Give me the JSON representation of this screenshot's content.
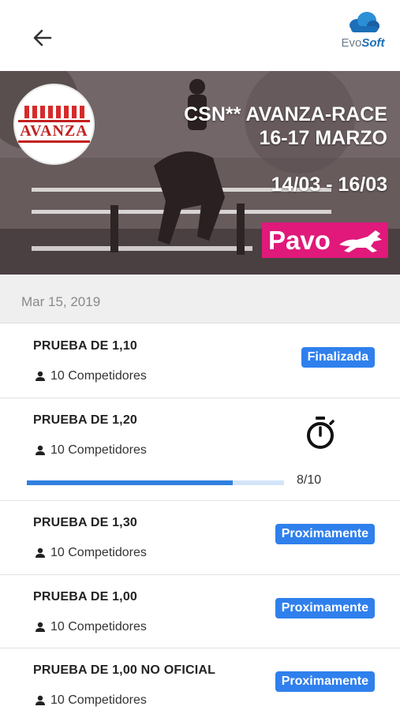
{
  "header": {
    "back_icon": "arrow-left-icon",
    "logo": {
      "evo": "Evo",
      "soft": "Soft"
    }
  },
  "banner": {
    "logo_text": "AVANZA",
    "title_line1": "CSN** AVANZA-RACE",
    "title_line2": "16-17 MARZO",
    "dates": "14/03 - 16/03",
    "sponsor": "Pavo"
  },
  "date_header": "Mar 15, 2019",
  "colors": {
    "accent": "#2f80ed",
    "progress_track": "#d3e4fa",
    "sponsor": "#e0197a"
  },
  "events": [
    {
      "title": "PRUEBA DE 1,10",
      "competitors": "10 Competidores",
      "status": "Finalizada"
    },
    {
      "title": "PRUEBA DE 1,20",
      "competitors": "10 Competidores",
      "status": "",
      "icon": "stopwatch-icon",
      "progress": 0.8,
      "progress_label": "8/10"
    },
    {
      "title": "PRUEBA DE 1,30",
      "competitors": "10 Competidores",
      "status": "Proximamente"
    },
    {
      "title": "PRUEBA DE 1,00",
      "competitors": "10 Competidores",
      "status": "Proximamente"
    },
    {
      "title": "PRUEBA DE 1,00 NO OFICIAL",
      "competitors": "10 Competidores",
      "status": "Proximamente"
    }
  ]
}
